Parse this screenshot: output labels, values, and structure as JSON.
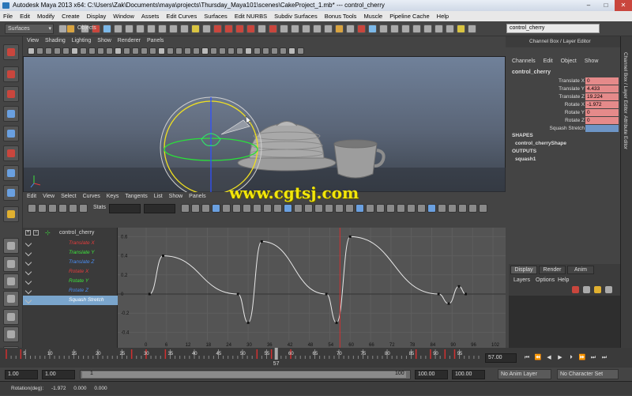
{
  "window": {
    "title": "Autodesk Maya 2013 x64: C:\\Users\\Zak\\Documents\\maya\\projects\\Thursday_Maya101\\scenes\\CakeProject_1.mb*  ---  control_cherry"
  },
  "menubar": [
    "File",
    "Edit",
    "Modify",
    "Create",
    "Display",
    "Window",
    "Assets",
    "Edit Curves",
    "Surfaces",
    "Edit NURBS",
    "Subdiv Surfaces",
    "Bonus Tools",
    "Muscle",
    "Pipeline Cache",
    "Help"
  ],
  "status": {
    "menuset": "Surfaces",
    "objects_label": "Objects",
    "name_field": "control_cherry"
  },
  "viewport": {
    "menus": [
      "View",
      "Shading",
      "Lighting",
      "Show",
      "Renderer",
      "Panels"
    ]
  },
  "graph_editor": {
    "menus": [
      "Edit",
      "View",
      "Select",
      "Curves",
      "Keys",
      "Tangents",
      "List",
      "Show",
      "Panels"
    ],
    "stats_label": "Stats",
    "outliner_root": "control_cherry",
    "channels": [
      {
        "name": "Translate X",
        "color": "#e23c3c"
      },
      {
        "name": "Translate Y",
        "color": "#3ce23c"
      },
      {
        "name": "Translate Z",
        "color": "#4a8cf0"
      },
      {
        "name": "Rotate X",
        "color": "#e23c3c"
      },
      {
        "name": "Rotate Y",
        "color": "#3ce23c"
      },
      {
        "name": "Rotate Z",
        "color": "#4a8cf0"
      },
      {
        "name": "Squash Stretch",
        "color": "#ffffff"
      }
    ],
    "y_ticks": [
      "0.6",
      "0.4",
      "0.2",
      "0",
      "-0.2",
      "-0.4",
      "-0.6"
    ],
    "x_ticks": [
      "0",
      "6",
      "12",
      "18",
      "24",
      "30",
      "36",
      "42",
      "48",
      "54",
      "60",
      "66",
      "72",
      "78",
      "84",
      "90",
      "96",
      "102"
    ],
    "current_frame": "57"
  },
  "channel_box": {
    "header": "Channel Box / Layer Editor",
    "menus": [
      "Channels",
      "Edit",
      "Object",
      "Show"
    ],
    "object": "control_cherry",
    "attrs": [
      {
        "label": "Translate X",
        "value": "0"
      },
      {
        "label": "Translate Y",
        "value": "4.433"
      },
      {
        "label": "Translate Z",
        "value": "19.224"
      },
      {
        "label": "Rotate X",
        "value": "-1.972"
      },
      {
        "label": "Rotate Y",
        "value": "0"
      },
      {
        "label": "Rotate Z",
        "value": "0"
      },
      {
        "label": "Squash Stretch",
        "value": ""
      }
    ],
    "shapes_label": "SHAPES",
    "shape": "control_cherryShape",
    "outputs_label": "OUTPUTS",
    "output": "squash1",
    "side_tabs": [
      "Channel Box / Layer Editor",
      "Attribute Editor"
    ],
    "layer_tabs": [
      "Display",
      "Render",
      "Anim"
    ],
    "layer_menus": [
      "Layers",
      "Options",
      "Help"
    ]
  },
  "time_slider": {
    "ticks": [
      "5",
      "10",
      "15",
      "20",
      "25",
      "30",
      "35",
      "40",
      "45",
      "50",
      "55",
      "60",
      "65",
      "70",
      "75",
      "80",
      "85",
      "90",
      "95"
    ],
    "current": "57",
    "end_field": "57.00"
  },
  "range": {
    "start": "1.00",
    "inner_start": "1.00",
    "slider_start": "1",
    "slider_end": "100",
    "end": "100.00",
    "end2": "100.00",
    "anim_layer": "No Anim Layer",
    "character": "No Character Set"
  },
  "command_line": {
    "label": "Rotation(deg):",
    "vals": [
      "-1.972",
      "0.000",
      "0.000"
    ]
  },
  "watermark": "www.cgtsj.com"
}
